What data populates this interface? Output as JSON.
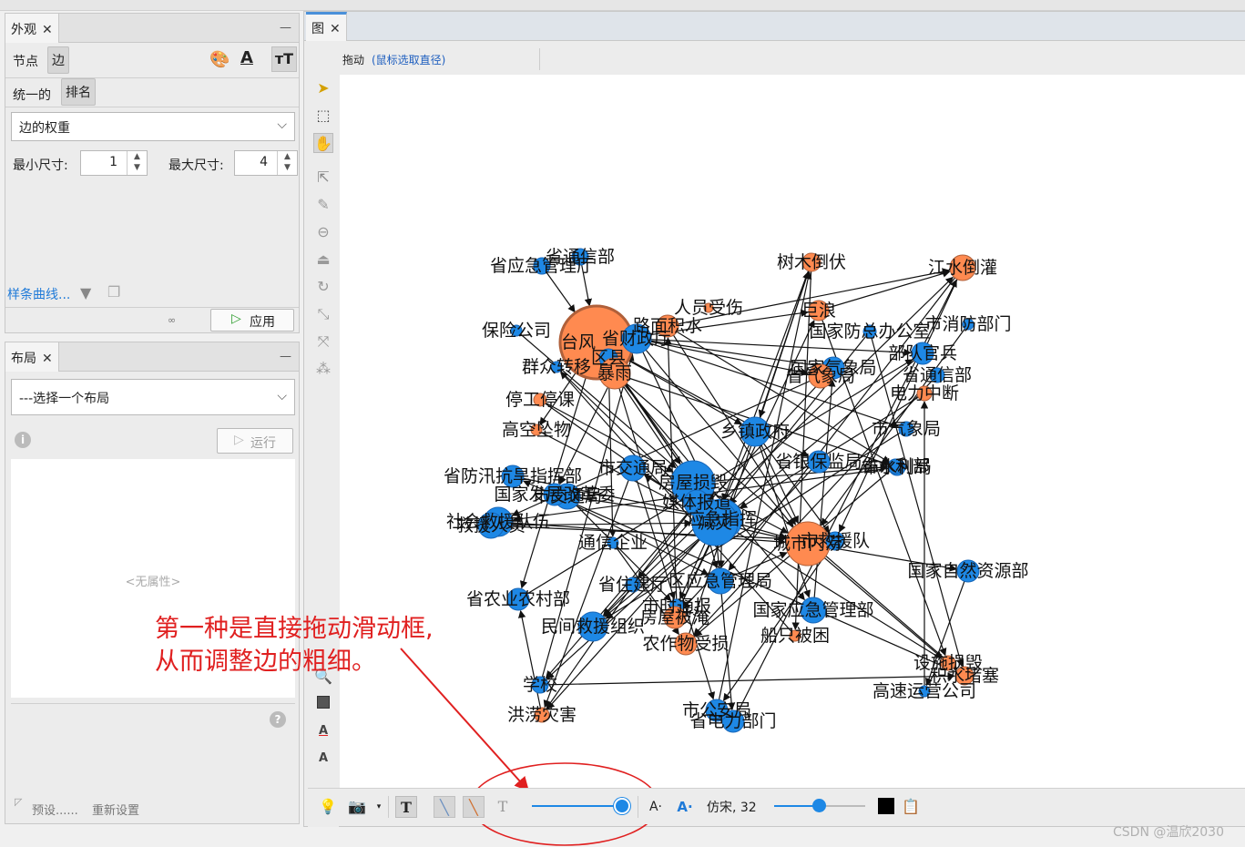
{
  "appearance_panel": {
    "tab_label": "外观",
    "node_tab": "节点",
    "edge_tab": "边",
    "unified_tab": "统一的",
    "ranking_tab": "排名",
    "ranking_attribute": "边的权重",
    "min_size_label": "最小尺寸:",
    "min_size_value": "1",
    "max_size_label": "最大尺寸:",
    "max_size_value": "4",
    "spline_link": "样条曲线...",
    "apply_button": "应用"
  },
  "layout_panel": {
    "tab_label": "布局",
    "layout_select": "---选择一个布局",
    "run_button": "运行",
    "no_properties": "<无属性>",
    "presets_label": "预设......",
    "reset_label": "重新设置"
  },
  "graph_panel": {
    "tab_label": "图",
    "drag_label": "拖动",
    "drag_hint": "(鼠标选取直径)"
  },
  "bottom_toolbar": {
    "font_label": "仿宋, 32",
    "edge_thickness_slider_fraction": 0.97,
    "label_size_slider_fraction": 0.5,
    "label_color": "#000000"
  },
  "annotation": {
    "line1": "第一种是直接拖动滑动框,",
    "line2": "从而调整边的粗细。",
    "color": "#e02020"
  },
  "watermark": "CSDN @温欣2030",
  "colors": {
    "blue_node": "#1e88e5",
    "orange_node": "#ff8a50",
    "accent": "#1f7ad8"
  },
  "graph_labels": [
    "省应急管理厅",
    "省通信部",
    "树木倒伏",
    "江水倒灌",
    "人员受伤",
    "保险公司",
    "台风",
    "省财政厅",
    "路面积水",
    "巨浪",
    "国家防总办公室",
    "市消防部门",
    "群众转移",
    "区县",
    "暴雨",
    "部队官兵",
    "国家气象局",
    "省气象局",
    "电力中断",
    "省通信部",
    "停工停课",
    "高空坠物",
    "乡镇政府",
    "市交通局",
    "房屋损毁",
    "市气象局",
    "市水利局",
    "省防汛抗旱指挥部",
    "市交通局",
    "媒体报道",
    "省银保监局",
    "省水利部",
    "国家发展改革委",
    "应急指挥",
    "社会救援队伍",
    "救援人员",
    "减灾",
    "城市内涝",
    "市救援队",
    "国家自然资源部",
    "通信企业",
    "省住建厅",
    "区应急管理局",
    "省农业农村部",
    "市时通报",
    "民间救援组织",
    "房屋被淹",
    "农作物受损",
    "船只被困",
    "国家应急管理部",
    "省电力部门",
    "设施损毁",
    "积水堵塞",
    "学校",
    "洪涝灾害",
    "市公安局",
    "高速运营公司"
  ]
}
